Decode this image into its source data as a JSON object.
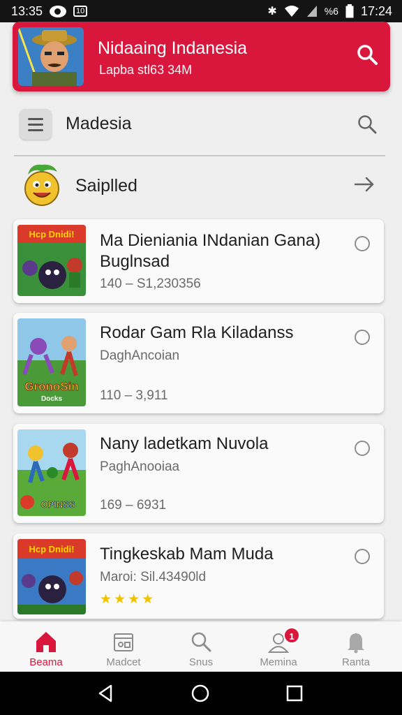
{
  "status_bar": {
    "time_left": "13:35",
    "time_right": "17:24",
    "box_label": "10",
    "net_label": "%6"
  },
  "header": {
    "title": "Nidaaing Indanesia",
    "subtitle": "Lapba stl63 34M",
    "accent_color": "#d9173d"
  },
  "toolbar": {
    "title": "Madesia"
  },
  "section": {
    "label": "Saiplled"
  },
  "items": [
    {
      "title": "Ma Dieniania INdanian Gana) Buglnsad",
      "meta": "140 – S1,230356"
    },
    {
      "title": "Rodar Gam Rla Kiladanss",
      "subtitle": "DaghAncoian",
      "meta": "110 – 3,911",
      "thumb_caption": "GronoSin",
      "thumb_caption2": "Docks"
    },
    {
      "title": "Nany ladetkam Nuvola",
      "subtitle": "PaghAnooiaa",
      "meta": "169 – 6931",
      "thumb_caption": "OPINSS"
    },
    {
      "title": "Tingkeskab Mam Muda",
      "subtitle": "Maroi: Sil.43490ld",
      "rating": "★★★★"
    }
  ],
  "thumb_banner": "Hcp Dnidi!",
  "bottom_nav": [
    {
      "label": "Beama",
      "icon": "home-icon",
      "active": true
    },
    {
      "label": "Madcet",
      "icon": "market-icon"
    },
    {
      "label": "Snus",
      "icon": "search-icon"
    },
    {
      "label": "Memina",
      "icon": "profile-icon",
      "badge": "1"
    },
    {
      "label": "Ranta",
      "icon": "bell-icon"
    }
  ]
}
